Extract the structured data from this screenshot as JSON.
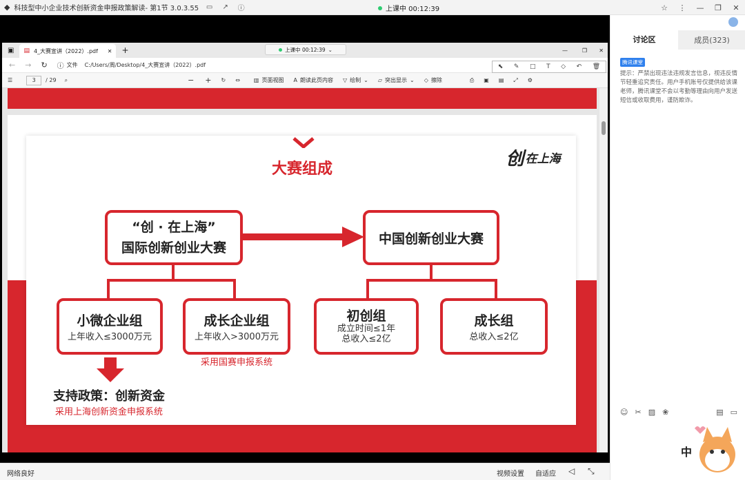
{
  "app": {
    "title": "科技型中小企业技术创新资金申报政策解读- 第1节 3.0.3.55",
    "live_status": "上课中 00:12:39"
  },
  "browser": {
    "tab_title": "4_大赛宣讲（2022）.pdf",
    "tab_live": "上课中 00:12:39",
    "address_label": "文件",
    "address": "C:/Users/周/Desktop/4_大赛宣讲（2022）.pdf",
    "page_current": "3",
    "page_total": "/ 29",
    "toolbar": {
      "page_view": "页面视图",
      "read_aloud": "朗读此页内容",
      "draw": "绘制",
      "highlight": "突出显示",
      "erase": "擦除"
    }
  },
  "slide": {
    "title": "大赛组成",
    "logo_text": "在上海",
    "top_left": {
      "line1": "“创 · 在上海”",
      "line2": "国际创新创业大赛"
    },
    "top_right": "中国创新创业大赛",
    "groups": [
      {
        "name": "小微企业组",
        "sub1": "上年收入≤3000万元",
        "sub2": ""
      },
      {
        "name": "成长企业组",
        "sub1": "上年收入>3000万元",
        "sub2": ""
      },
      {
        "name": "初创组",
        "sub1": "成立时间≤1年",
        "sub2": "总收入≤2亿"
      },
      {
        "name": "成长组",
        "sub1": "总收入≤2亿",
        "sub2": ""
      }
    ],
    "note_growth": "采用国赛申报系统",
    "support_title": "支持政策：创新资金",
    "support_sub": "采用上海创新资金申报系统"
  },
  "panel": {
    "tab_discussion": "讨论区",
    "tab_members": "成员(323)",
    "badge": "腾讯课堂",
    "notice": "提示：严禁出现违法违规发言信息，视违反情节轻重追究责任。用户手机账号仅提供给该课老师，腾讯课堂不会以考勤等理由向用户发送短信或收取费用，谨防欺诈。"
  },
  "bottom": {
    "network": "网络良好",
    "video_settings": "视频设置",
    "adaptive": "自适应"
  },
  "colors": {
    "accent_red": "#d7262d",
    "live_green": "#2ecc71"
  }
}
